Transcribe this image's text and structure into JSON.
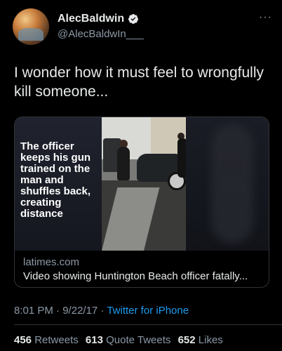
{
  "user": {
    "display_name": "AlecBaldwin",
    "handle": "@AlecBaldwIn___",
    "verified": true,
    "more_icon": "more-icon"
  },
  "tweet": {
    "text": "I wonder how it must feel to wrongfully kill someone..."
  },
  "card": {
    "caption": "The officer keeps his gun trained on the man and shuffles back, creating distance",
    "domain": "latimes.com",
    "title": "Video showing Huntington Beach officer fatally..."
  },
  "meta": {
    "time": "8:01 PM",
    "date": "9/22/17",
    "separator": "·",
    "source": "Twitter for iPhone"
  },
  "stats": {
    "retweets_count": "456",
    "retweets_label": "Retweets",
    "quotes_count": "613",
    "quotes_label": "Quote Tweets",
    "likes_count": "652",
    "likes_label": "Likes"
  },
  "colors": {
    "background": "#000000",
    "text": "#e7e9ea",
    "muted": "#8b98a5",
    "link": "#1d9bf0"
  }
}
